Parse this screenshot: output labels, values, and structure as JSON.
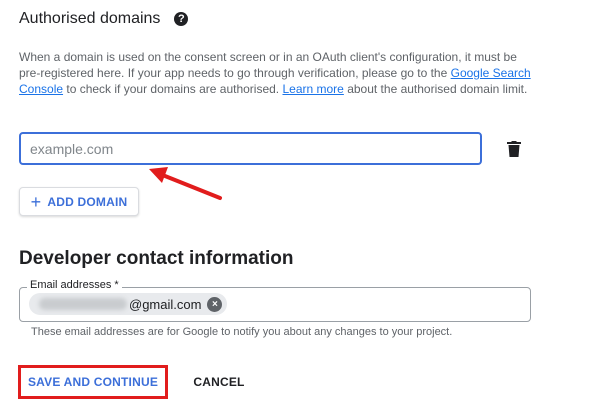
{
  "authorised_domains": {
    "title": "Authorised domains",
    "help_icon": "help-circle-icon",
    "description": {
      "part1": "When a domain is used on the consent screen or in an OAuth client's configuration, it must be pre-registered here. If your app needs to go through verification, please go to the ",
      "link1": "Google Search Console",
      "part2": " to check if your domains are authorised. ",
      "link2": "Learn more",
      "part3": " about the authorised domain limit."
    },
    "input_placeholder": "example.com",
    "input_value": "",
    "delete_icon": "trash-icon",
    "add_button": {
      "icon": "plus-icon",
      "label": "ADD DOMAIN"
    }
  },
  "developer_contact": {
    "title": "Developer contact information",
    "email_label": "Email addresses *",
    "email_chip": {
      "suffix": "@gmail.com",
      "remove_icon": "close-circle-icon"
    },
    "helper_text": "These email addresses are for Google to notify you about any changes to your project."
  },
  "actions": {
    "save_label": "SAVE AND CONTINUE",
    "cancel_label": "CANCEL"
  },
  "annotations": {
    "highlight_color": "#e11d1d",
    "accent_color": "#3c6fd9"
  }
}
